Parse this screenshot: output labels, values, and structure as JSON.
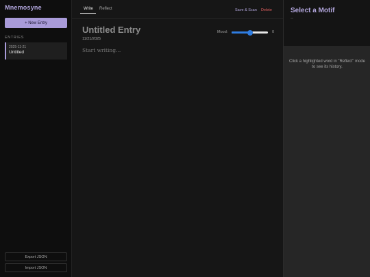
{
  "sidebar": {
    "app_name": "Mnemosyne",
    "new_entry_label": "+ New Entry",
    "entries_heading": "ENTRIES",
    "entries": [
      {
        "date": "2025-11-21",
        "title": "Untitled"
      }
    ],
    "export_label": "Export JSON",
    "import_label": "Import JSON"
  },
  "tabs": [
    {
      "label": "Write",
      "active": true
    },
    {
      "label": "Reflect",
      "active": false
    }
  ],
  "toolbar": {
    "save_scan_label": "Save & Scan",
    "delete_label": "Delete"
  },
  "entry": {
    "title": "Untitled Entry",
    "date": "11/21/2025",
    "placeholder": "Start writing..."
  },
  "mood": {
    "label": "Mood:",
    "value": 0,
    "value_text": "0",
    "min": -5,
    "max": 5
  },
  "motif": {
    "title": "Select a Motif",
    "subtitle": "--",
    "hint": "Click a highlighted word in \"Reflect\" mode to see its history."
  },
  "colors": {
    "accent": "#a99bd9",
    "danger": "#e26060",
    "slider": "#2f7de1"
  }
}
